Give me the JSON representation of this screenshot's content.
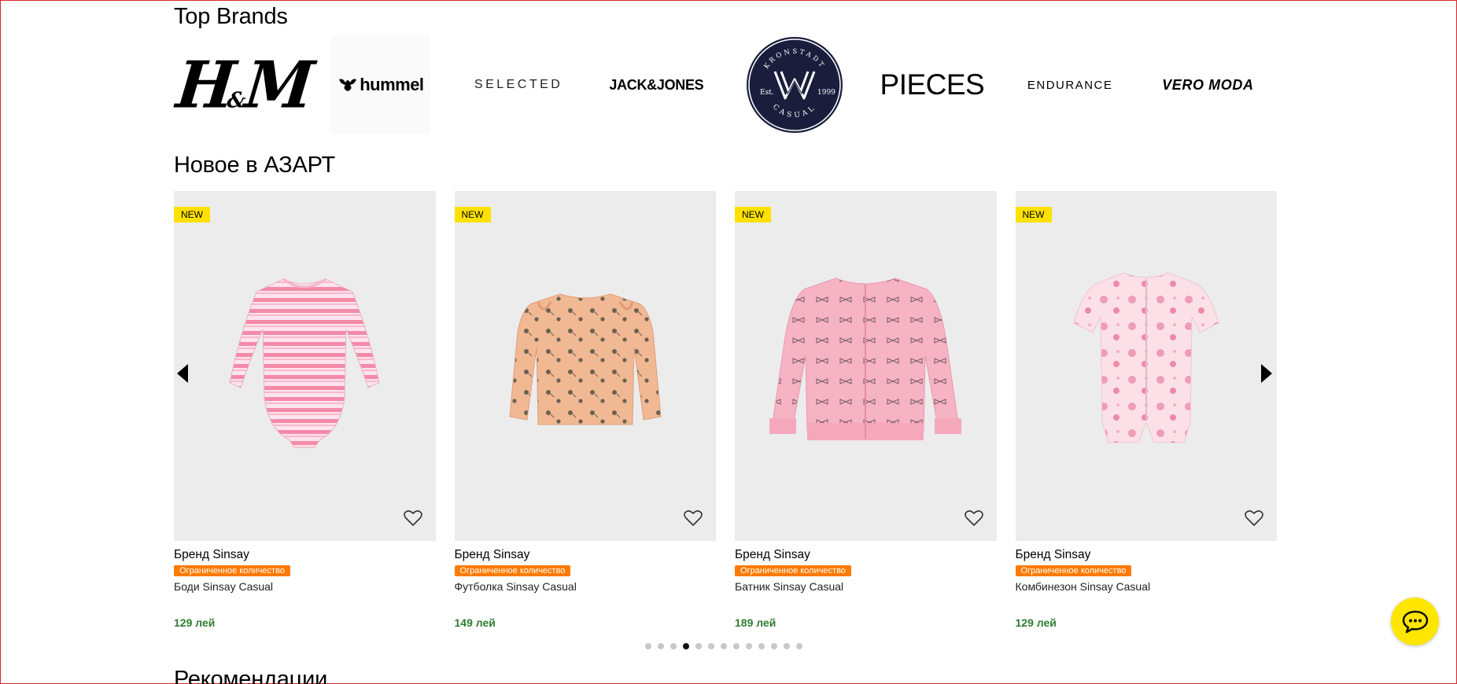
{
  "sections": {
    "brands_title": "Top Brands",
    "new_title": "Новое в АЗАРТ",
    "recommendations_title": "Рекомендации"
  },
  "brands": [
    {
      "name": "H&M",
      "icon": "hm-logo"
    },
    {
      "name": "hummel",
      "icon": "hummel-logo"
    },
    {
      "name": "SELECTED",
      "icon": "selected-logo"
    },
    {
      "name": "JACK&JONES",
      "icon": "jack-jones-logo"
    },
    {
      "name": "KRONSTADT CASUAL",
      "icon": "kronstadt-logo",
      "est": "Est.",
      "year": "1999"
    },
    {
      "name": "PIECES",
      "icon": "pieces-logo"
    },
    {
      "name": "ENDURANCE",
      "icon": "endurance-logo"
    },
    {
      "name": "VERO MODA",
      "icon": "vero-moda-logo"
    }
  ],
  "products": [
    {
      "badge": "NEW",
      "brand": "Бренд Sinsay",
      "limited": "Ограниченное количество",
      "name": "Боди Sinsay Casual",
      "price": "129 лей",
      "image": "striped-bodysuit"
    },
    {
      "badge": "NEW",
      "brand": "Бренд Sinsay",
      "limited": "Ограниченное количество",
      "name": "Футболка Sinsay Casual",
      "price": "149 лей",
      "image": "floral-long-sleeve-top"
    },
    {
      "badge": "NEW",
      "brand": "Бренд Sinsay",
      "limited": "Ограниченное количество",
      "name": "Батник Sinsay Casual",
      "price": "189 лей",
      "image": "pink-bow-print-jacket"
    },
    {
      "badge": "NEW",
      "brand": "Бренд Sinsay",
      "limited": "Ограниченное количество",
      "name": "Комбинезон Sinsay Casual",
      "price": "129 лей",
      "image": "floral-romper"
    }
  ],
  "carousel": {
    "page_count": 13,
    "active_page": 4
  },
  "colors": {
    "badge_new": "#ffe100",
    "limited": "#ff7a00",
    "price": "#2e7d32",
    "chat": "#ffe600"
  },
  "icons": {
    "favorite": "heart-outline-icon",
    "prev": "arrow-left-icon",
    "next": "arrow-right-icon",
    "chat": "chat-icon"
  }
}
